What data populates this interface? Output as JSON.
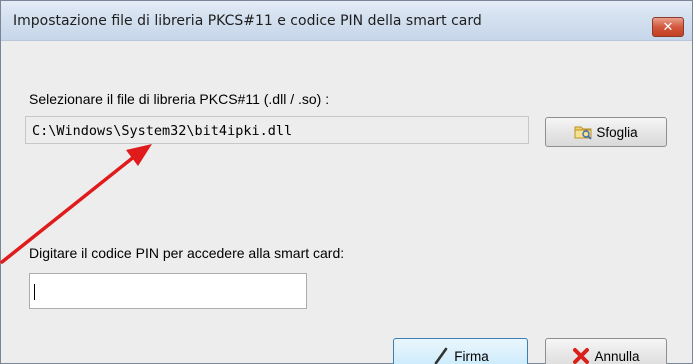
{
  "window": {
    "title": "Impostazione file di libreria PKCS#11 e codice PIN della smart card",
    "close_glyph": "✕"
  },
  "library": {
    "label": "Selezionare il file di libreria PKCS#11 (.dll / .so) :",
    "path": "C:\\Windows\\System32\\bit4ipki.dll",
    "browse_label": "Sfoglia",
    "browse_icon": "folder-icon"
  },
  "pin": {
    "label": "Digitare il codice PIN per accedere alla smart card:",
    "value": ""
  },
  "actions": {
    "sign_label": "Firma",
    "sign_icon": "pen-icon",
    "cancel_label": "Annulla",
    "cancel_icon": "red-x-icon"
  },
  "colors": {
    "annotation_arrow": "#e01b1b",
    "close_button": "#d2573e"
  }
}
